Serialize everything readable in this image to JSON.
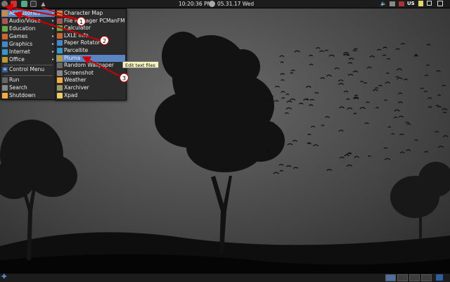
{
  "panel_top": {
    "clock": "10:20:36 PM",
    "date": "05.31.17 Wed",
    "keyboard_layout": "US"
  },
  "main_menu": {
    "items": [
      {
        "label": "Accessories",
        "icon": "accessories-icon",
        "has_submenu": true,
        "selected": true
      },
      {
        "label": "Audio/Video",
        "icon": "audio-video-icon",
        "has_submenu": true
      },
      {
        "label": "Education",
        "icon": "education-icon",
        "has_submenu": true
      },
      {
        "label": "Games",
        "icon": "games-icon",
        "has_submenu": true
      },
      {
        "label": "Graphics",
        "icon": "graphics-icon",
        "has_submenu": true
      },
      {
        "label": "Internet",
        "icon": "internet-icon",
        "has_submenu": true
      },
      {
        "label": "Office",
        "icon": "office-icon",
        "has_submenu": true
      }
    ],
    "control_menu": "Control Menu",
    "bottom_items": [
      {
        "label": "Run",
        "icon": "run-icon"
      },
      {
        "label": "Search",
        "icon": "search-icon"
      },
      {
        "label": "Shutdown",
        "icon": "shutdown-icon"
      }
    ]
  },
  "submenu": {
    "items": [
      {
        "label": "Character Map",
        "icon": "character-map-icon"
      },
      {
        "label": "File Manager PCManFM",
        "icon": "file-manager-icon"
      },
      {
        "label": "Calculator",
        "icon": "calculator-icon"
      },
      {
        "label": "LXLE Info",
        "icon": "info-icon"
      },
      {
        "label": "Paper Rotator",
        "icon": "paper-rotator-icon"
      },
      {
        "label": "Parcellite",
        "icon": "parcellite-icon"
      },
      {
        "label": "Pluma",
        "icon": "pluma-icon",
        "selected": true
      },
      {
        "label": "Random Wallpaper",
        "icon": "wallpaper-icon"
      },
      {
        "label": "Screenshot",
        "icon": "screenshot-icon"
      },
      {
        "label": "Weather",
        "icon": "weather-icon"
      },
      {
        "label": "Xarchiver",
        "icon": "xarchiver-icon"
      },
      {
        "label": "Xpad",
        "icon": "xpad-icon"
      }
    ]
  },
  "tooltip": "Edit text files",
  "callouts": [
    "1",
    "2",
    "3"
  ],
  "colors": {
    "selection": "#5b84c4",
    "annotation": "#cc0000",
    "panel": "#1c1c1c"
  }
}
